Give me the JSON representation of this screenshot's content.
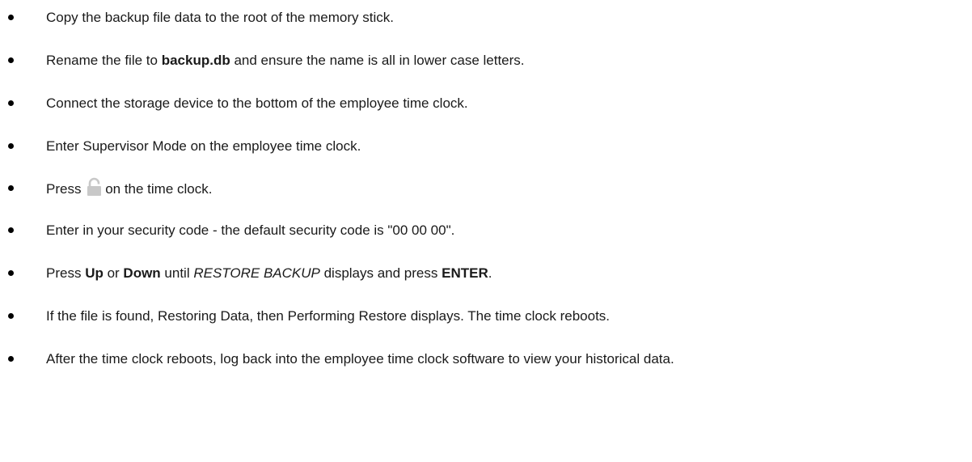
{
  "steps": [
    {
      "text": "Copy the backup file data to the root of the memory stick."
    },
    {
      "pre": "Rename the file to ",
      "bold": "backup.db",
      "post": " and ensure the name is all in lower case letters."
    },
    {
      "text": "Connect the storage device to the bottom of the employee time clock."
    },
    {
      "text": "Enter Supervisor Mode on the employee time clock."
    },
    {
      "pre": "Press ",
      "icon": "lock-icon",
      "post": "on the time clock."
    },
    {
      "text": "Enter in your security code - the default security code is \"00 00 00\"."
    },
    {
      "pre": "Press ",
      "up": "Up",
      "or": " or ",
      "down": "Down",
      "until": " until ",
      "italic": "RESTORE BACKUP",
      "displays": " displays and press ",
      "enter": "ENTER",
      "end": "."
    },
    {
      "text": "If the file is found, Restoring Data, then Performing Restore displays. The time clock reboots."
    },
    {
      "text": "After the time clock reboots, log back into the employee time clock software to view your historical data."
    }
  ],
  "colors": {
    "text": "#1a1a1a",
    "bullet": "#000000",
    "lock_icon": "#c8c8c8"
  }
}
